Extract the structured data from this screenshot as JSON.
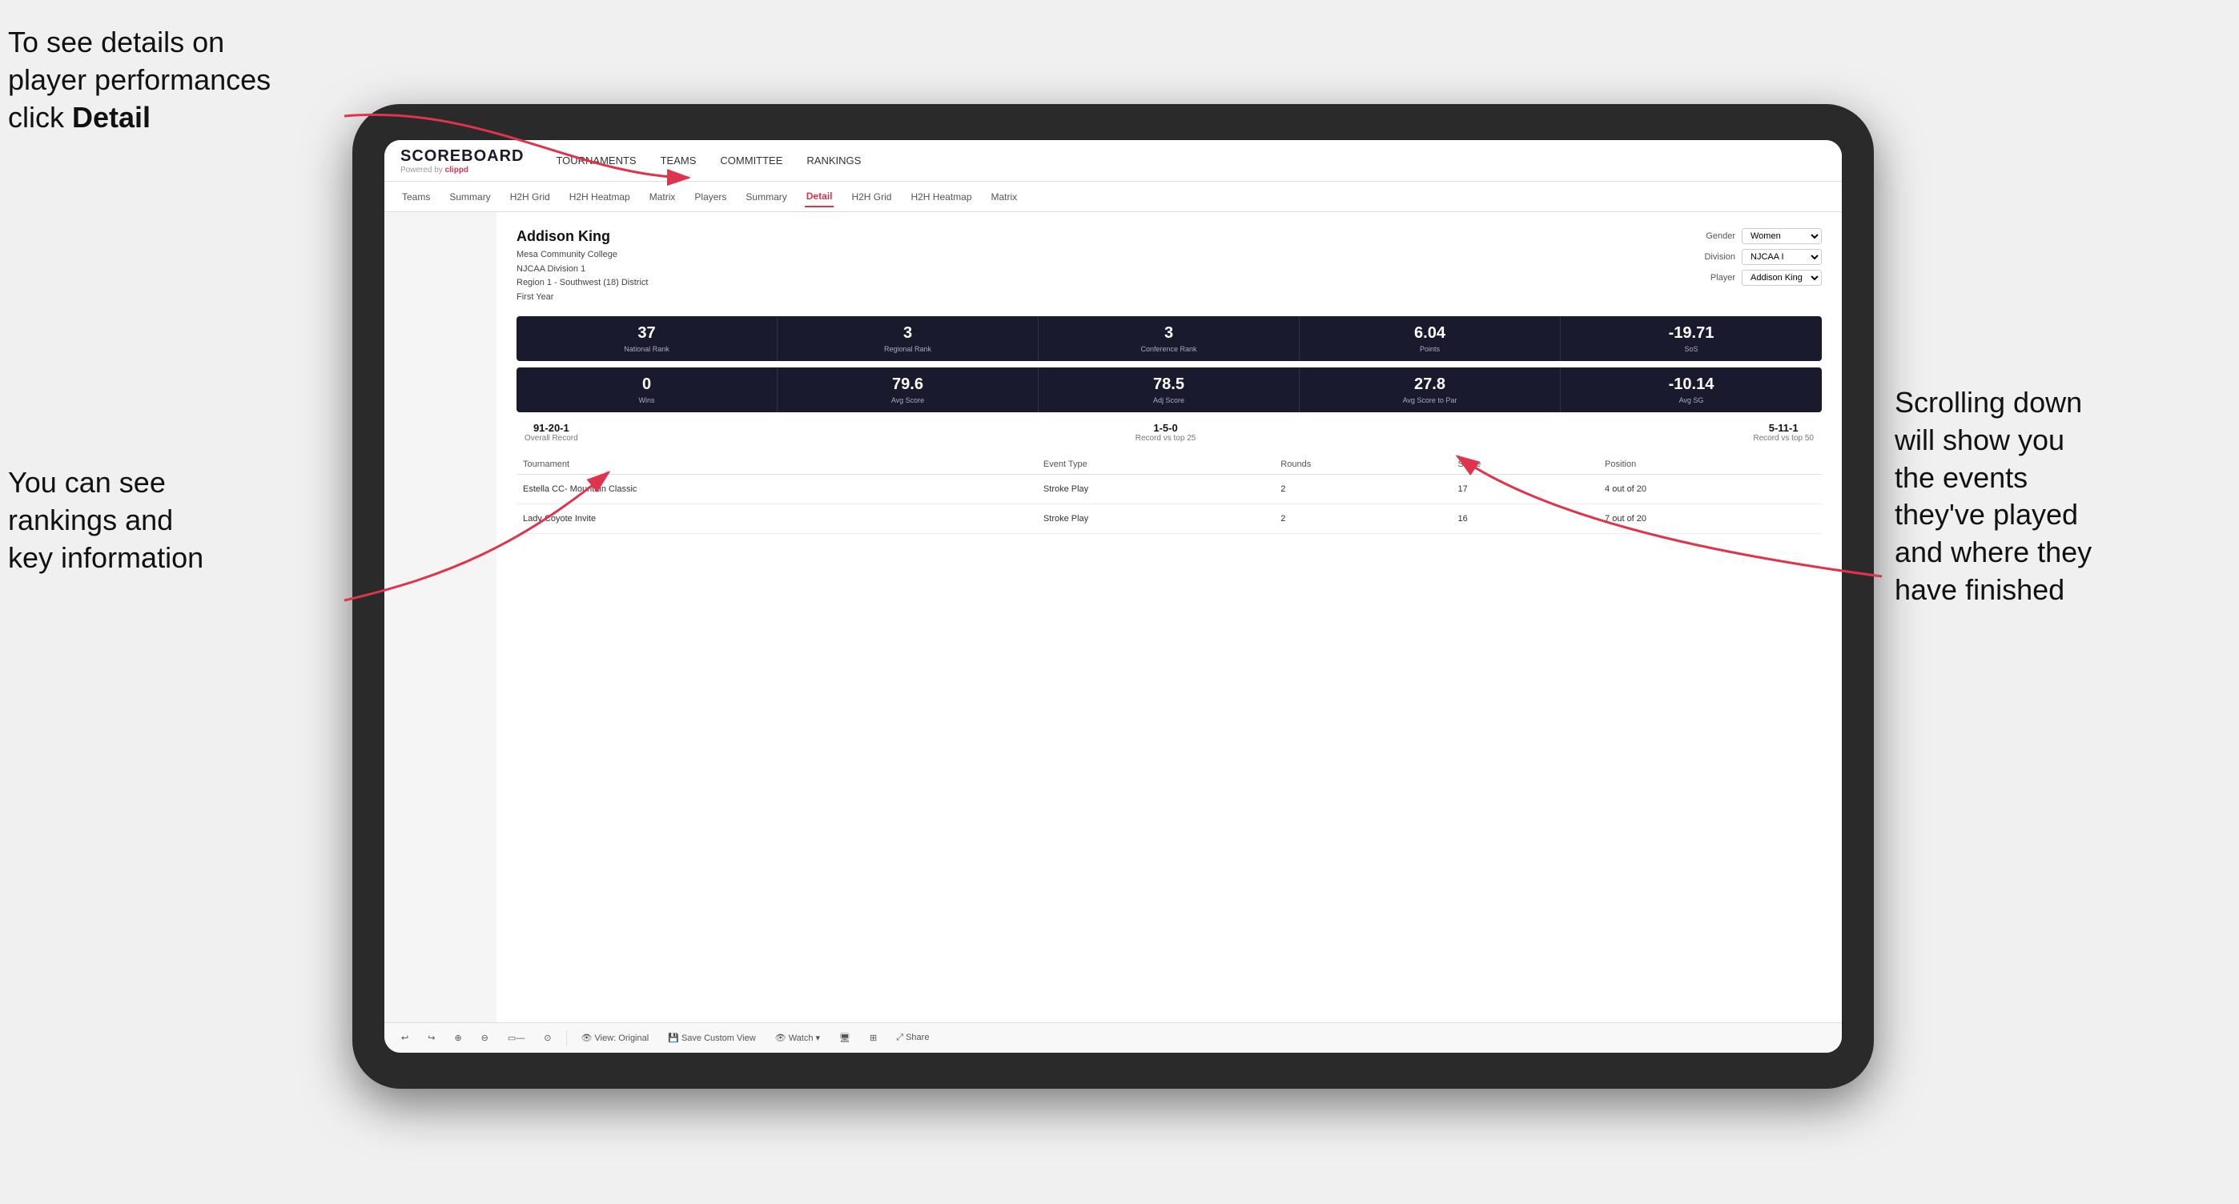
{
  "annotations": {
    "topleft_line1": "To see details on",
    "topleft_line2": "player performances",
    "topleft_line3": "click ",
    "topleft_bold": "Detail",
    "bottomleft_line1": "You can see",
    "bottomleft_line2": "rankings and",
    "bottomleft_line3": "key information",
    "right_line1": "Scrolling down",
    "right_line2": "will show you",
    "right_line3": "the events",
    "right_line4": "they've played",
    "right_line5": "and where they",
    "right_line6": "have finished"
  },
  "nav": {
    "logo": "SCOREBOARD",
    "powered_by": "Powered by ",
    "brand": "clippd",
    "items": [
      {
        "label": "TOURNAMENTS",
        "active": false
      },
      {
        "label": "TEAMS",
        "active": false
      },
      {
        "label": "COMMITTEE",
        "active": false
      },
      {
        "label": "RANKINGS",
        "active": false
      }
    ]
  },
  "subnav": {
    "items": [
      {
        "label": "Teams",
        "active": false
      },
      {
        "label": "Summary",
        "active": false
      },
      {
        "label": "H2H Grid",
        "active": false
      },
      {
        "label": "H2H Heatmap",
        "active": false
      },
      {
        "label": "Matrix",
        "active": false
      },
      {
        "label": "Players",
        "active": false
      },
      {
        "label": "Summary",
        "active": false
      },
      {
        "label": "Detail",
        "active": true
      },
      {
        "label": "H2H Grid",
        "active": false
      },
      {
        "label": "H2H Heatmap",
        "active": false
      },
      {
        "label": "Matrix",
        "active": false
      }
    ]
  },
  "player": {
    "name": "Addison King",
    "school": "Mesa Community College",
    "division": "NJCAA Division 1",
    "region": "Region 1 - Southwest (18) District",
    "year": "First Year"
  },
  "selectors": {
    "gender_label": "Gender",
    "gender_value": "Women",
    "division_label": "Division",
    "division_value": "NJCAA I",
    "player_label": "Player",
    "player_value": "Addison King"
  },
  "stats_row1": [
    {
      "value": "37",
      "label": "National Rank"
    },
    {
      "value": "3",
      "label": "Regional Rank"
    },
    {
      "value": "3",
      "label": "Conference Rank"
    },
    {
      "value": "6.04",
      "label": "Points"
    },
    {
      "value": "-19.71",
      "label": "SoS"
    }
  ],
  "stats_row2": [
    {
      "value": "0",
      "label": "Wins"
    },
    {
      "value": "79.6",
      "label": "Avg Score"
    },
    {
      "value": "78.5",
      "label": "Adj Score"
    },
    {
      "value": "27.8",
      "label": "Avg Score to Par"
    },
    {
      "value": "-10.14",
      "label": "Avg SG"
    }
  ],
  "records": [
    {
      "value": "91-20-1",
      "label": "Overall Record"
    },
    {
      "value": "1-5-0",
      "label": "Record vs top 25"
    },
    {
      "value": "5-11-1",
      "label": "Record vs top 50"
    }
  ],
  "table": {
    "headers": [
      "Tournament",
      "Event Type",
      "Rounds",
      "Score",
      "Position"
    ],
    "rows": [
      {
        "tournament": "Estella CC- Mountain Classic",
        "event_type": "Stroke Play",
        "rounds": "2",
        "score": "17",
        "position": "4 out of 20"
      },
      {
        "tournament": "Lady Coyote Invite",
        "event_type": "Stroke Play",
        "rounds": "2",
        "score": "16",
        "position": "7 out of 20"
      }
    ]
  },
  "toolbar": {
    "buttons": [
      {
        "label": "↩",
        "name": "undo"
      },
      {
        "label": "↪",
        "name": "redo"
      },
      {
        "label": "⊕",
        "name": "zoom-fit"
      },
      {
        "label": "⊖",
        "name": "zoom-out"
      },
      {
        "label": "▭-",
        "name": "layout"
      },
      {
        "label": "⊙",
        "name": "refresh"
      },
      {
        "label": "👁 View: Original",
        "name": "view-original"
      },
      {
        "label": "💾 Save Custom View",
        "name": "save-view"
      },
      {
        "label": "👁 Watch ▾",
        "name": "watch"
      },
      {
        "label": "🖥",
        "name": "display"
      },
      {
        "label": "⊞",
        "name": "grid-view"
      },
      {
        "label": "⤢ Share",
        "name": "share"
      }
    ]
  }
}
